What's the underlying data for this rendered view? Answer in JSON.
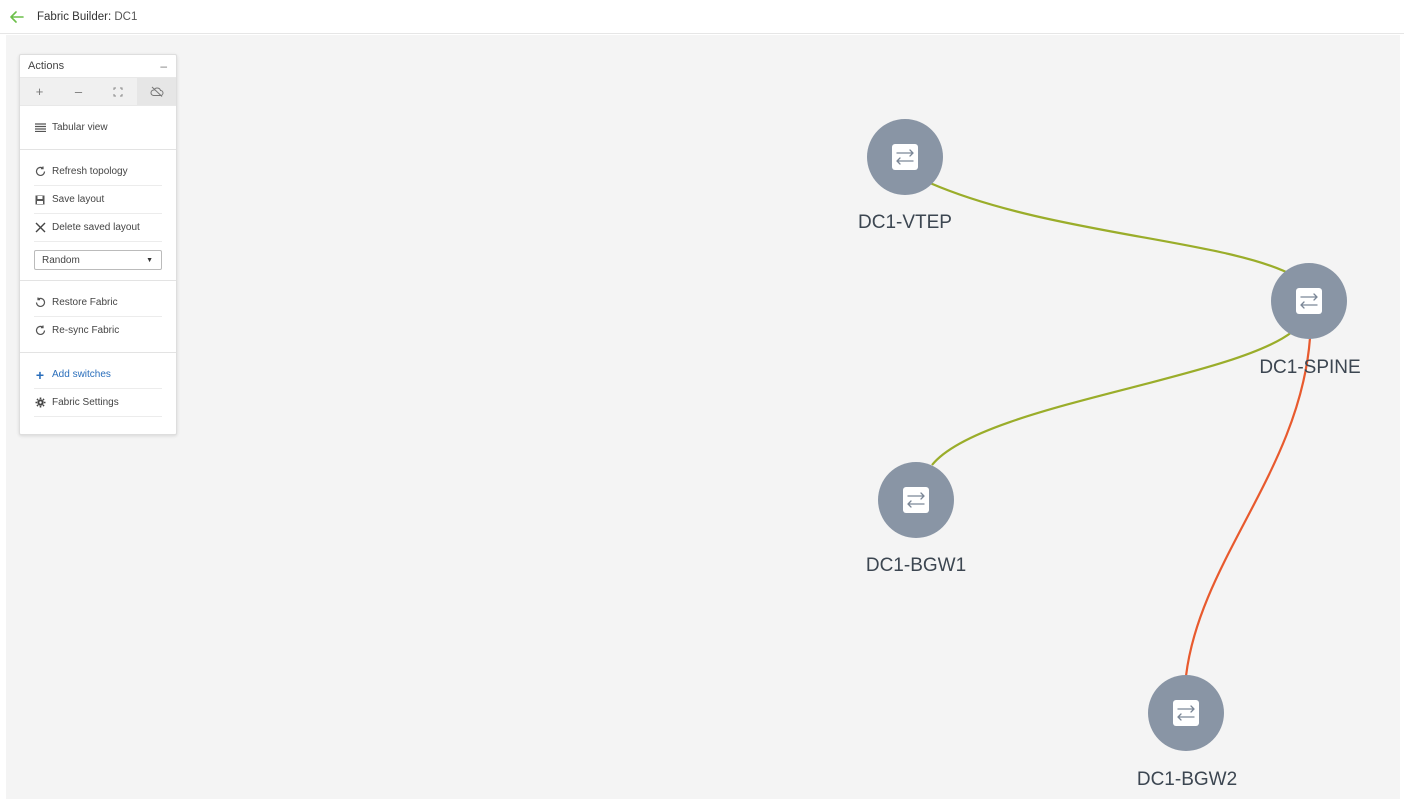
{
  "header": {
    "title_prefix": "Fabric Builder:",
    "title_fabric": "DC1"
  },
  "actions_panel": {
    "title": "Actions",
    "collapse_symbol": "–",
    "zoom_controls": [
      {
        "icon": "zoom-in-icon",
        "glyph": "+"
      },
      {
        "icon": "zoom-out-icon",
        "glyph": "–"
      },
      {
        "icon": "fit-screen-icon",
        "glyph": "⛶"
      },
      {
        "icon": "cloud-off-icon",
        "glyph": "☁"
      }
    ],
    "tabular_view": "Tabular view",
    "refresh_topology": "Refresh topology",
    "save_layout": "Save layout",
    "delete_saved_layout": "Delete saved layout",
    "layout_select": "Random",
    "restore_fabric": "Restore Fabric",
    "resync_fabric": "Re-sync Fabric",
    "add_switches": "Add switches",
    "fabric_settings": "Fabric Settings"
  },
  "topology": {
    "nodes": [
      {
        "id": "vtep",
        "label": "DC1-VTEP"
      },
      {
        "id": "spine",
        "label": "DC1-SPINE"
      },
      {
        "id": "bgw1",
        "label": "DC1-BGW1"
      },
      {
        "id": "bgw2",
        "label": "DC1-BGW2"
      }
    ],
    "links": [
      {
        "from": "vtep",
        "to": "spine",
        "color": "#9aad2a"
      },
      {
        "from": "spine",
        "to": "bgw1",
        "color": "#9aad2a"
      },
      {
        "from": "spine",
        "to": "bgw2",
        "color": "#e85a2e"
      }
    ],
    "node_color": "#8995a5"
  }
}
